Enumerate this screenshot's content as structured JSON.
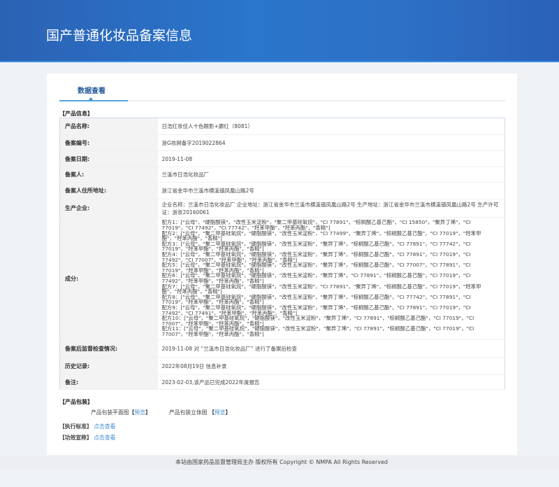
{
  "header": {
    "title": "国产普通化妆品备案信息"
  },
  "tab": {
    "label": "数据查看"
  },
  "product_info": {
    "section_title": "【产品信息】",
    "rows": [
      {
        "label": "产品名称:",
        "value": "日浩红妆佳人十色眼影+腮红（8081）"
      },
      {
        "label": "备案编号:",
        "value": "浙G妆网备字2019022864"
      },
      {
        "label": "备案日期:",
        "value": "2019-11-08"
      },
      {
        "label": "备案人:",
        "value": "兰溪市日浩化妆品厂"
      },
      {
        "label": "备案人住所地址:",
        "value": "浙江省金华市兰溪市横溪镇凤凰山路2号"
      },
      {
        "label": "生产企业:",
        "value": "企业名称：兰溪市日浩化妆品厂 企业地址：浙江省金华市兰溪市横溪镇凤凰山路2号 生产地址：浙江省金华市兰溪市横溪镇凤凰山路2号 生产许可证：浙妆20160061"
      }
    ],
    "ingredients": {
      "label": "成分:",
      "formulas": [
        "配方1：[\"云母\"，\"硬脂酸镁\"，\"改性玉米淀粉\"，\"聚二甲基硅氧烷\"，\"CI 77891\"，\"棕榈酸乙基己酯\"，\"CI 15850\"，\"聚异丁烯\"，\"CI 77019\"，\"CI 77492\"，\"CI 77742\"，\"羟苯甲酯\"，\"羟苯丙酯\"，\"香精\"]",
        "配方2：[\"云母\"，\"聚二甲基硅氧烷\"，\"硬脂酸镁\"，\"改性玉米淀粉\"，\"CI 77499\"，\"聚异丁烯\"，\"棕榈酸乙基己酯\"，\"CI 77019\"，\"羟苯甲酯\"，\"羟苯丙酯\"，\"香精\"]",
        "配方3：[\"云母\"，\"聚二甲基硅氧烷\"，\"硬脂酸镁\"，\"改性玉米淀粉\"，\"聚异丁烯\"，\"棕榈酸乙基己酯\"，\"CI 77891\"，\"CI 77742\"，\"CI 77019\"，\"羟苯甲酯\"，\"羟苯丙酯\"，\"香精\"]",
        "配方4：[\"云母\"，\"聚二甲基硅氧烷\"，\"硬脂酸镁\"，\"改性玉米淀粉\"，\"聚异丁烯\"，\"棕榈酸乙基己酯\"，\"CI 77891\"，\"CI 77019\"，\"CI 77492\"，\"CI 77007\"，\"羟苯甲酯\"，\"羟苯丙酯\"，\"香精\"]",
        "配方5：[\"云母\"，\"聚二甲基硅氧烷\"，\"硬脂酸镁\"，\"改性玉米淀粉\"，\"聚异丁烯\"，\"棕榈酸乙基己酯\"，\"CI 77007\"，\"CI 77891\"，\"CI 77019\"，\"羟苯甲酯\"，\"羟苯丙酯\"，\"香精\"]",
        "配方6：[\"云母\"，\"聚二甲基硅氧烷\"，\"硬脂酸镁\"，\"改性玉米淀粉\"，\"聚异丁烯\"，\"CI 77891\"，\"棕榈酸乙基己酯\"，\"CI 77019\"，\"CI 77492\"，\"羟苯甲酯\"，\"羟苯丙酯\"，\"香精\"]",
        "配方7：[\"云母\"，\"聚二甲基硅氧烷\"，\"硬脂酸镁\"，\"改性玉米淀粉\"，\"CI 77891\"，\"聚异丁烯\"，\"棕榈酸乙基己酯\"，\"CI 77019\"，\"羟苯甲酯\"，\"羟苯丙酯\"，\"香精\"]",
        "配方8：[\"云母\"，\"聚二甲基硅氧烷\"，\"硬脂酸镁\"，\"改性玉米淀粉\"，\"聚异丁烯\"，\"棕榈酸乙基己酯\"，\"CI 77742\"，\"CI 77891\"，\"CI 77019\"，\"羟苯甲酯\"，\"羟苯丙酯\"，\"香精\"]",
        "配方9：[\"云母\"，\"聚二甲基硅氧烷\"，\"硬脂酸镁\"，\"改性玉米淀粉\"，\"聚异丁烯\"，\"棕榈酸乙基己酯\"，\"CI 77891\"，\"CI 77019\"，\"CI 77492\"，\"CI 77491\"，\"羟苯甲酯\"，\"羟苯丙酯\"，\"香精\"]",
        "配方10：[\"云母\"，\"聚二甲基硅氧烷\"，\"硬脂酸镁\"，\"改性玉米淀粉\"，\"聚异丁烯\"，\"CI 77891\"，\"棕榈酸乙基己酯\"，\"CI 77019\"，\"CI 77007\"，\"羟苯甲酯\"，\"羟苯丙酯\"，\"香精\"]",
        "配方11：[\"云母\"，\"聚二甲基硅氧烷\"，\"硬脂酸镁\"，\"改性玉米淀粉\"，\"聚异丁烯\"，\"CI 77891\"，\"棕榈酸乙基己酯\"，\"CI 77019\"，\"CI 77007\"，\"羟苯甲酯\"，\"羟苯丙酯\"，\"香精\"]"
      ]
    },
    "rows2": [
      {
        "label": "备案后监督检查情况:",
        "value": "2019-11-08 对 “兰溪市日浩化妆品厂” 进行了备案后检查"
      },
      {
        "label": "历史记录:",
        "value": "2022年08月19日 信息补录"
      },
      {
        "label": "备注:",
        "value": "2023-02-03,该产品已完成2022年度报告"
      }
    ]
  },
  "packaging": {
    "section_title": "【产品包装】",
    "flat_label": "产品包装平面图",
    "solid_label": "产品包装立体图",
    "bracket_open": "【",
    "bracket_close": "】",
    "preview": "预览"
  },
  "standard": {
    "label": "【执行标准】",
    "link": "点击查看"
  },
  "efficacy": {
    "label": "【功效宣称】",
    "link": "点击查看"
  },
  "footer": {
    "text": "本站由国家药品监督管理局主办 版权所有 Copyright © NMPA All Rights Reserved"
  }
}
